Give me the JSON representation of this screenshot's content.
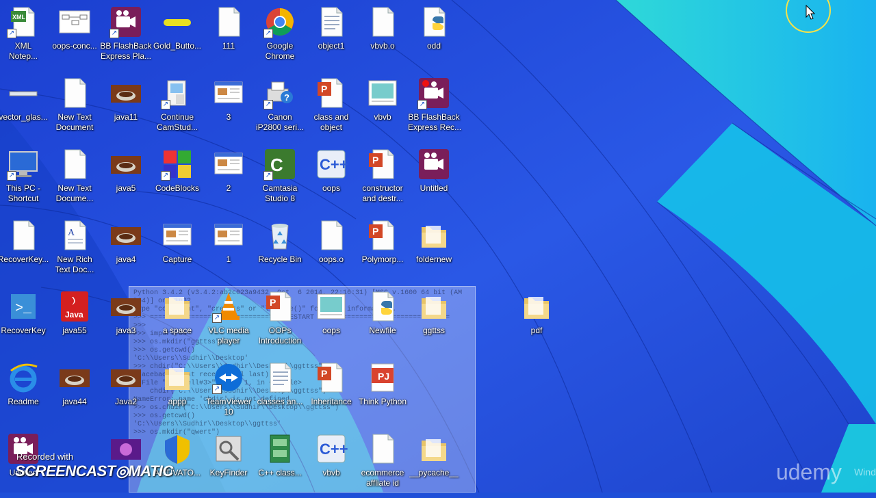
{
  "desktop": {
    "icons": [
      {
        "label": "XML\nNotep...",
        "icon": "xml-notepad-icon",
        "shortcut": true
      },
      {
        "label": "oops-conc...",
        "icon": "diagram-doc-icon",
        "shortcut": false
      },
      {
        "label": "BB FlashBack\nExpress Pla...",
        "icon": "bb-flashback-icon",
        "shortcut": true
      },
      {
        "label": "Gold_Butto...",
        "icon": "gold-button-icon",
        "shortcut": false
      },
      {
        "label": "111",
        "icon": "blank-file-icon",
        "shortcut": false
      },
      {
        "label": "Google\nChrome",
        "icon": "chrome-icon",
        "shortcut": true
      },
      {
        "label": "object1",
        "icon": "text-doc-icon",
        "shortcut": false
      },
      {
        "label": "vbvb.o",
        "icon": "blank-file-icon",
        "shortcut": false
      },
      {
        "label": "odd",
        "icon": "python-file-icon",
        "shortcut": false
      },
      {
        "label": "vector_glas...",
        "icon": "glass-bar-icon",
        "shortcut": false
      },
      {
        "label": "New Text\nDocument",
        "icon": "blank-file-icon",
        "shortcut": false
      },
      {
        "label": "java11",
        "icon": "java-image-icon",
        "shortcut": false
      },
      {
        "label": "Continue\nCamStud...",
        "icon": "camstudio-icon",
        "shortcut": true
      },
      {
        "label": "3",
        "icon": "screenshot-icon",
        "shortcut": false
      },
      {
        "label": "Canon\niP2800 seri...",
        "icon": "printer-help-icon",
        "shortcut": true
      },
      {
        "label": "class and\nobject",
        "icon": "powerpoint-icon",
        "shortcut": false
      },
      {
        "label": "vbvb",
        "icon": "image-file-icon",
        "shortcut": false
      },
      {
        "label": "BB FlashBack\nExpress Rec...",
        "icon": "bb-flashback-rec-icon",
        "shortcut": true
      },
      {
        "label": "This PC -\nShortcut",
        "icon": "this-pc-icon",
        "shortcut": true
      },
      {
        "label": "New Text\nDocume...",
        "icon": "blank-file-icon",
        "shortcut": false
      },
      {
        "label": "java5",
        "icon": "java-image-icon",
        "shortcut": false
      },
      {
        "label": "CodeBlocks",
        "icon": "codeblocks-icon",
        "shortcut": true
      },
      {
        "label": "2",
        "icon": "screenshot-icon",
        "shortcut": false
      },
      {
        "label": "Camtasia\nStudio 8",
        "icon": "camtasia-icon",
        "shortcut": true
      },
      {
        "label": "oops",
        "icon": "cpp-file-icon",
        "shortcut": false
      },
      {
        "label": "constructor\nand destr...",
        "icon": "powerpoint-icon",
        "shortcut": false
      },
      {
        "label": "Untitled",
        "icon": "bb-flashback-icon",
        "shortcut": false
      },
      {
        "label": "RecoverKey...",
        "icon": "blank-file-icon",
        "shortcut": false
      },
      {
        "label": "New Rich\nText Doc...",
        "icon": "rich-text-icon",
        "shortcut": false
      },
      {
        "label": "java4",
        "icon": "java-image-icon",
        "shortcut": false
      },
      {
        "label": "Capture",
        "icon": "screenshot-icon",
        "shortcut": false
      },
      {
        "label": "1",
        "icon": "screenshot-icon",
        "shortcut": false
      },
      {
        "label": "Recycle Bin",
        "icon": "recycle-bin-icon",
        "shortcut": false
      },
      {
        "label": "oops.o",
        "icon": "blank-file-icon",
        "shortcut": false
      },
      {
        "label": "Polymorp...",
        "icon": "powerpoint-icon",
        "shortcut": false
      },
      {
        "label": "foldernew",
        "icon": "folder-icon",
        "shortcut": false
      },
      {
        "label": "RecoverKey",
        "icon": "recoverkey-icon",
        "shortcut": false
      },
      {
        "label": "java55",
        "icon": "java-logo-icon",
        "shortcut": false
      },
      {
        "label": "java3",
        "icon": "java-image-icon",
        "shortcut": false
      },
      {
        "label": "a space",
        "icon": "folder-icon",
        "shortcut": false
      },
      {
        "label": "VLC media\nplayer",
        "icon": "vlc-icon",
        "shortcut": true
      },
      {
        "label": "OOPs\nIntroduction",
        "icon": "powerpoint-icon",
        "shortcut": false
      },
      {
        "label": "oops",
        "icon": "image-file-icon",
        "shortcut": false
      },
      {
        "label": "Newfile",
        "icon": "python-file-icon",
        "shortcut": false
      },
      {
        "label": "ggttss",
        "icon": "folder-icon",
        "shortcut": false
      },
      {
        "label": "pdf",
        "icon": "folder-icon",
        "shortcut": false
      },
      {
        "label": "Readme",
        "icon": "ie-icon",
        "shortcut": false
      },
      {
        "label": "java44",
        "icon": "java-image-icon",
        "shortcut": false
      },
      {
        "label": "Java2",
        "icon": "java-image-icon",
        "shortcut": false
      },
      {
        "label": "appp",
        "icon": "folder-icon",
        "shortcut": false
      },
      {
        "label": "TeamViewer\n10",
        "icon": "teamviewer-icon",
        "shortcut": true
      },
      {
        "label": "classes an...",
        "icon": "text-doc-icon",
        "shortcut": false
      },
      {
        "label": "Inheritance",
        "icon": "powerpoint-icon",
        "shortcut": false
      },
      {
        "label": "Think Python",
        "icon": "pdf-icon",
        "shortcut": false
      },
      {
        "label": "Untitled",
        "icon": "bb-flashback-icon",
        "shortcut": false
      },
      {
        "label": "",
        "icon": "purple-image-icon",
        "shortcut": false
      },
      {
        "label": "ACTIVATO...",
        "icon": "activator-icon",
        "shortcut": false
      },
      {
        "label": "KeyFinder",
        "icon": "keyfinder-icon",
        "shortcut": false
      },
      {
        "label": "C++ class...",
        "icon": "cabinet-icon",
        "shortcut": false
      },
      {
        "label": "vbvb",
        "icon": "cpp-file-icon",
        "shortcut": false
      },
      {
        "label": "ecommerce\naffliate id",
        "icon": "blank-file-icon",
        "shortcut": false
      },
      {
        "label": "__pycache__",
        "icon": "folder-icon",
        "shortcut": false
      }
    ]
  },
  "ghost_window": {
    "lines": [
      "Python 3.4.2 (v3.4.2:ab2c023a9432, Oct  6 2014, 22:16:31) [MSC v.1600 64 bit (AM",
      "D64)] on win32",
      "Type \"copyright\", \"credits\" or \"license()\" for more information.",
      ">>> ================================ RESTART ================================",
      ">>> ",
      ">>> import os",
      ">>> os.mkdir(\"ggttss\")",
      ">>> os.getcwd()",
      "'C:\\\\Users\\\\Sudhir\\\\Desktop'",
      ">>> chdir(\"C:\\\\Users\\\\Sudhir\\\\Desktop\\\\ggttss\")",
      "Traceback (most recent call last):",
      "  File \"<pyshell#3>\", line 1, in <module>",
      "    chdir(\"C:\\\\Users\\\\Sudhir\\\\Desktop\\\\ggttss\")",
      "NameError: name 'chdir' is not defined",
      ">>> os.chdir(\"C:\\\\Users\\\\Sudhir\\\\Desktop\\\\ggttss\")",
      ">>> os.getcwd()",
      "'C:\\\\Users\\\\Sudhir\\\\Desktop\\\\ggttss'",
      ">>> os.mkdir(\"qwert\")"
    ]
  },
  "watermarks": {
    "recorded_with": "Recorded with",
    "screencast": "SCREENCAST◎MATIC",
    "udemy": "udemy",
    "windows": "Wind"
  },
  "colors": {
    "wallpaper_blue": "#1f4fd8",
    "wallpaper_cyan": "#22d3e8",
    "cursor_ring": "#f5e24a"
  }
}
